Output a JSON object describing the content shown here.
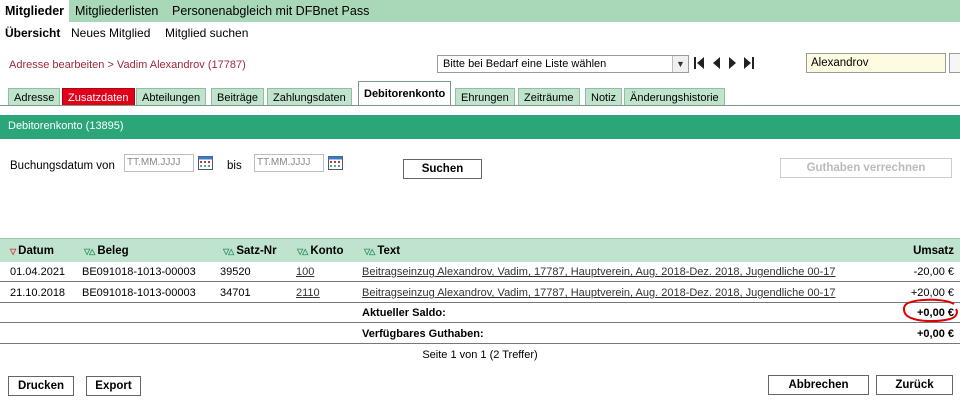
{
  "top_nav": [
    "Mitglieder",
    "Mitgliederlisten",
    "Personenabgleich mit DFBnet Pass"
  ],
  "sub_nav": [
    "Übersicht",
    "Neues Mitglied",
    "Mitglied suchen"
  ],
  "breadcrumb": "Adresse bearbeiten > Vadim Alexandrov (17787)",
  "list_select": {
    "value": "Bitte bei Bedarf eine Liste wählen"
  },
  "search": {
    "value": "Alexandrov"
  },
  "tabs": [
    "Adresse",
    "Zusatzdaten",
    "Abteilungen",
    "Beiträge",
    "Zahlungsdaten",
    "Debitorenkonto",
    "Ehrungen",
    "Zeiträume",
    "Notiz",
    "Änderungshistorie"
  ],
  "section_title": "Debitorenkonto  (13895)",
  "filter": {
    "label_from": "Buchungsdatum von",
    "label_to": "bis",
    "date_placeholder": "TT.MM.JJJJ",
    "search_button": "Suchen",
    "credit_button": "Guthaben verrechnen"
  },
  "table": {
    "headers": {
      "datum": "Datum",
      "beleg": "Beleg",
      "satz": "Satz-Nr",
      "konto": "Konto",
      "text": "Text",
      "umsatz": "Umsatz"
    },
    "rows": [
      {
        "datum": "01.04.2021",
        "beleg": "BE091018-1013-00003",
        "satz": "39520",
        "konto": "100",
        "text": "Beitragseinzug Alexandrov, Vadim, 17787, Hauptverein, Aug. 2018-Dez. 2018, Jugendliche 00-17",
        "umsatz": "-20,00 €"
      },
      {
        "datum": "21.10.2018",
        "beleg": "BE091018-1013-00003",
        "satz": "34701",
        "konto": "2110",
        "text": "Beitragseinzug Alexandrov, Vadim, 17787, Hauptverein, Aug. 2018-Dez. 2018, Jugendliche 00-17",
        "umsatz": "+20,00 €"
      }
    ],
    "saldo_label": "Aktueller Saldo:",
    "saldo_value": "+0,00 €",
    "guthaben_label": "Verfügbares Guthaben:",
    "guthaben_value": "+0,00 €"
  },
  "pager": "Seite 1 von 1 (2 Treffer)",
  "footer": {
    "print": "Drucken",
    "export": "Export",
    "cancel": "Abbrechen",
    "back": "Zurück"
  },
  "colors": {
    "nav_bg": "#a8d8b8",
    "section_bg": "#2aa679",
    "tab_red": "#e0001a",
    "breadcrumb": "#a0283c",
    "highlight_circle": "#e00000"
  }
}
